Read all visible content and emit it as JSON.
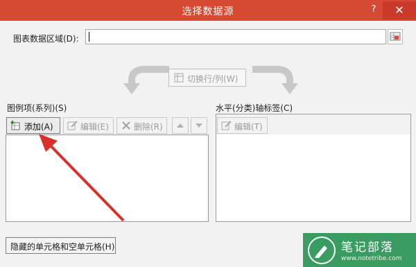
{
  "window": {
    "title": "选择数据源",
    "help_label": "?",
    "close_label": "✕"
  },
  "range": {
    "label": "图表数据区域(D):",
    "value": ""
  },
  "switch_button": {
    "label": "切换行/列(W)"
  },
  "legend_series": {
    "label": "图例项(系列)(S)",
    "buttons": {
      "add": "添加(A)",
      "edit": "编辑(E)",
      "delete": "删除(R)"
    },
    "items": []
  },
  "axis_labels": {
    "label": "水平(分类)轴标签(C)",
    "buttons": {
      "edit": "编辑(T)"
    },
    "items": []
  },
  "hidden_cells_button": {
    "label": "隐藏的单元格和空单元格(H)"
  },
  "watermark": {
    "title": "笔记部落",
    "url": "www.notetribe.com"
  },
  "colors": {
    "title_bar": "#d64a33",
    "annotation_arrow": "#d9302a",
    "watermark_bg": "#3a9c60"
  },
  "icons": [
    "chart-range-icon",
    "switch-row-column-icon",
    "add-series-icon",
    "edit-icon",
    "delete-icon",
    "move-up-icon",
    "move-down-icon"
  ]
}
